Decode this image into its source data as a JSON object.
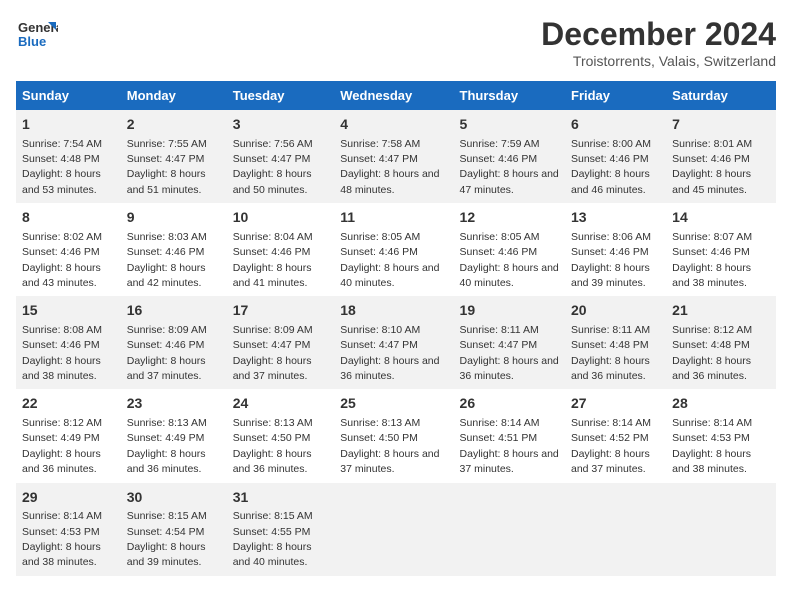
{
  "logo": {
    "line1": "General",
    "line2": "Blue"
  },
  "title": "December 2024",
  "subtitle": "Troistorrents, Valais, Switzerland",
  "days_of_week": [
    "Sunday",
    "Monday",
    "Tuesday",
    "Wednesday",
    "Thursday",
    "Friday",
    "Saturday"
  ],
  "weeks": [
    [
      {
        "day": "1",
        "sunrise": "Sunrise: 7:54 AM",
        "sunset": "Sunset: 4:48 PM",
        "daylight": "Daylight: 8 hours and 53 minutes."
      },
      {
        "day": "2",
        "sunrise": "Sunrise: 7:55 AM",
        "sunset": "Sunset: 4:47 PM",
        "daylight": "Daylight: 8 hours and 51 minutes."
      },
      {
        "day": "3",
        "sunrise": "Sunrise: 7:56 AM",
        "sunset": "Sunset: 4:47 PM",
        "daylight": "Daylight: 8 hours and 50 minutes."
      },
      {
        "day": "4",
        "sunrise": "Sunrise: 7:58 AM",
        "sunset": "Sunset: 4:47 PM",
        "daylight": "Daylight: 8 hours and 48 minutes."
      },
      {
        "day": "5",
        "sunrise": "Sunrise: 7:59 AM",
        "sunset": "Sunset: 4:46 PM",
        "daylight": "Daylight: 8 hours and 47 minutes."
      },
      {
        "day": "6",
        "sunrise": "Sunrise: 8:00 AM",
        "sunset": "Sunset: 4:46 PM",
        "daylight": "Daylight: 8 hours and 46 minutes."
      },
      {
        "day": "7",
        "sunrise": "Sunrise: 8:01 AM",
        "sunset": "Sunset: 4:46 PM",
        "daylight": "Daylight: 8 hours and 45 minutes."
      }
    ],
    [
      {
        "day": "8",
        "sunrise": "Sunrise: 8:02 AM",
        "sunset": "Sunset: 4:46 PM",
        "daylight": "Daylight: 8 hours and 43 minutes."
      },
      {
        "day": "9",
        "sunrise": "Sunrise: 8:03 AM",
        "sunset": "Sunset: 4:46 PM",
        "daylight": "Daylight: 8 hours and 42 minutes."
      },
      {
        "day": "10",
        "sunrise": "Sunrise: 8:04 AM",
        "sunset": "Sunset: 4:46 PM",
        "daylight": "Daylight: 8 hours and 41 minutes."
      },
      {
        "day": "11",
        "sunrise": "Sunrise: 8:05 AM",
        "sunset": "Sunset: 4:46 PM",
        "daylight": "Daylight: 8 hours and 40 minutes."
      },
      {
        "day": "12",
        "sunrise": "Sunrise: 8:05 AM",
        "sunset": "Sunset: 4:46 PM",
        "daylight": "Daylight: 8 hours and 40 minutes."
      },
      {
        "day": "13",
        "sunrise": "Sunrise: 8:06 AM",
        "sunset": "Sunset: 4:46 PM",
        "daylight": "Daylight: 8 hours and 39 minutes."
      },
      {
        "day": "14",
        "sunrise": "Sunrise: 8:07 AM",
        "sunset": "Sunset: 4:46 PM",
        "daylight": "Daylight: 8 hours and 38 minutes."
      }
    ],
    [
      {
        "day": "15",
        "sunrise": "Sunrise: 8:08 AM",
        "sunset": "Sunset: 4:46 PM",
        "daylight": "Daylight: 8 hours and 38 minutes."
      },
      {
        "day": "16",
        "sunrise": "Sunrise: 8:09 AM",
        "sunset": "Sunset: 4:46 PM",
        "daylight": "Daylight: 8 hours and 37 minutes."
      },
      {
        "day": "17",
        "sunrise": "Sunrise: 8:09 AM",
        "sunset": "Sunset: 4:47 PM",
        "daylight": "Daylight: 8 hours and 37 minutes."
      },
      {
        "day": "18",
        "sunrise": "Sunrise: 8:10 AM",
        "sunset": "Sunset: 4:47 PM",
        "daylight": "Daylight: 8 hours and 36 minutes."
      },
      {
        "day": "19",
        "sunrise": "Sunrise: 8:11 AM",
        "sunset": "Sunset: 4:47 PM",
        "daylight": "Daylight: 8 hours and 36 minutes."
      },
      {
        "day": "20",
        "sunrise": "Sunrise: 8:11 AM",
        "sunset": "Sunset: 4:48 PM",
        "daylight": "Daylight: 8 hours and 36 minutes."
      },
      {
        "day": "21",
        "sunrise": "Sunrise: 8:12 AM",
        "sunset": "Sunset: 4:48 PM",
        "daylight": "Daylight: 8 hours and 36 minutes."
      }
    ],
    [
      {
        "day": "22",
        "sunrise": "Sunrise: 8:12 AM",
        "sunset": "Sunset: 4:49 PM",
        "daylight": "Daylight: 8 hours and 36 minutes."
      },
      {
        "day": "23",
        "sunrise": "Sunrise: 8:13 AM",
        "sunset": "Sunset: 4:49 PM",
        "daylight": "Daylight: 8 hours and 36 minutes."
      },
      {
        "day": "24",
        "sunrise": "Sunrise: 8:13 AM",
        "sunset": "Sunset: 4:50 PM",
        "daylight": "Daylight: 8 hours and 36 minutes."
      },
      {
        "day": "25",
        "sunrise": "Sunrise: 8:13 AM",
        "sunset": "Sunset: 4:50 PM",
        "daylight": "Daylight: 8 hours and 37 minutes."
      },
      {
        "day": "26",
        "sunrise": "Sunrise: 8:14 AM",
        "sunset": "Sunset: 4:51 PM",
        "daylight": "Daylight: 8 hours and 37 minutes."
      },
      {
        "day": "27",
        "sunrise": "Sunrise: 8:14 AM",
        "sunset": "Sunset: 4:52 PM",
        "daylight": "Daylight: 8 hours and 37 minutes."
      },
      {
        "day": "28",
        "sunrise": "Sunrise: 8:14 AM",
        "sunset": "Sunset: 4:53 PM",
        "daylight": "Daylight: 8 hours and 38 minutes."
      }
    ],
    [
      {
        "day": "29",
        "sunrise": "Sunrise: 8:14 AM",
        "sunset": "Sunset: 4:53 PM",
        "daylight": "Daylight: 8 hours and 38 minutes."
      },
      {
        "day": "30",
        "sunrise": "Sunrise: 8:15 AM",
        "sunset": "Sunset: 4:54 PM",
        "daylight": "Daylight: 8 hours and 39 minutes."
      },
      {
        "day": "31",
        "sunrise": "Sunrise: 8:15 AM",
        "sunset": "Sunset: 4:55 PM",
        "daylight": "Daylight: 8 hours and 40 minutes."
      },
      {
        "day": "",
        "sunrise": "",
        "sunset": "",
        "daylight": ""
      },
      {
        "day": "",
        "sunrise": "",
        "sunset": "",
        "daylight": ""
      },
      {
        "day": "",
        "sunrise": "",
        "sunset": "",
        "daylight": ""
      },
      {
        "day": "",
        "sunrise": "",
        "sunset": "",
        "daylight": ""
      }
    ]
  ]
}
